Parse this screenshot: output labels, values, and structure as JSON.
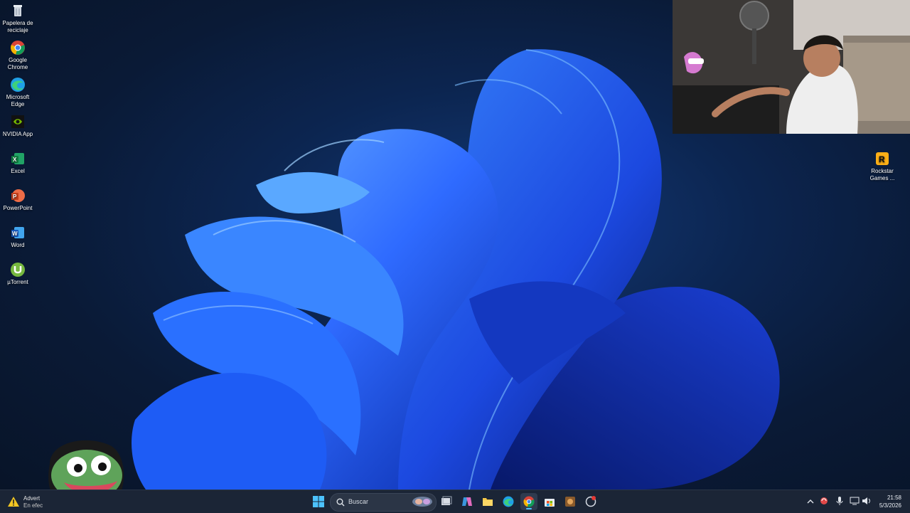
{
  "desktop": {
    "icons": [
      {
        "label": "Papelera de reciclaje",
        "icon": "recycle-bin-icon"
      },
      {
        "label": "Google Chrome",
        "icon": "chrome-icon"
      },
      {
        "label": "Microsoft Edge",
        "icon": "edge-icon"
      },
      {
        "label": "NVIDIA App",
        "icon": "nvidia-icon"
      },
      {
        "label": "Excel",
        "icon": "excel-icon"
      },
      {
        "label": "PowerPoint",
        "icon": "powerpoint-icon"
      },
      {
        "label": "Word",
        "icon": "word-icon"
      },
      {
        "label": "µTorrent",
        "icon": "utorrent-icon"
      }
    ],
    "right_icons": [
      {
        "label": "Rockstar Games ...",
        "icon": "rockstar-icon"
      }
    ]
  },
  "taskbar": {
    "warning": {
      "title": "Advert",
      "subtitle": "En efec"
    },
    "search_placeholder": "Buscar",
    "pinned": [
      "start-icon",
      "search-icon",
      "task-view-icon",
      "copilot-icon",
      "file-explorer-icon",
      "edge-icon",
      "chrome-icon",
      "store-icon",
      "game-icon",
      "recorder-icon"
    ],
    "clock": {
      "time": "21:58",
      "date": "5/3/2026"
    }
  },
  "colors": {
    "accent": "#2f6bff",
    "taskbar": "#1b2536",
    "warning": "#f3c623"
  }
}
